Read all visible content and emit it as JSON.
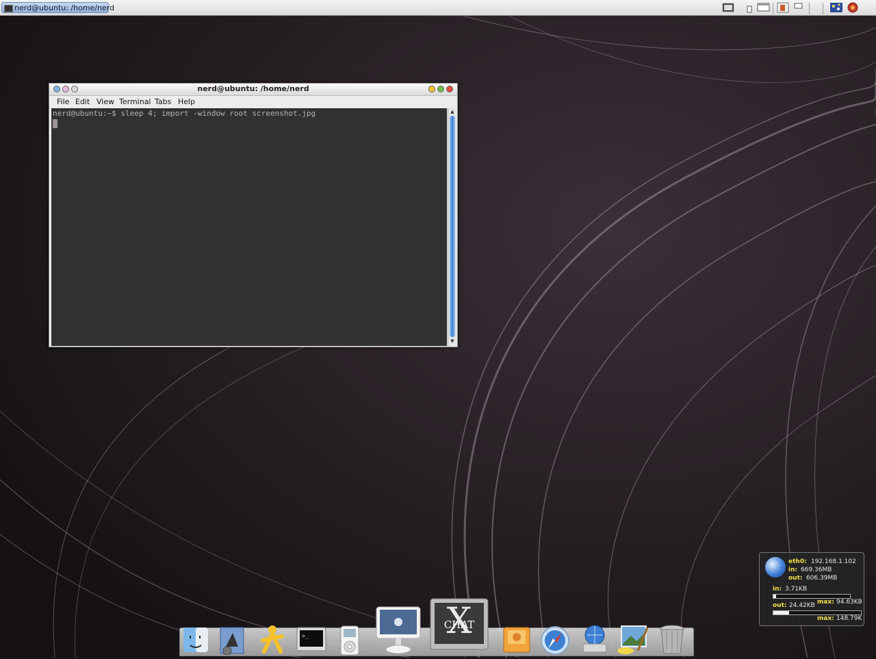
{
  "taskbar": {
    "window_button_label": "nerd@ubuntu: /home/nerd"
  },
  "tray_icons": [
    "workspace-switcher-icon",
    "user-icon",
    "window-icon",
    "clipboard-icon",
    "window-list-icon",
    "network-icon",
    "stars-icon",
    "power-icon"
  ],
  "terminal": {
    "title": "nerd@ubuntu: /home/nerd",
    "menus": [
      "File",
      "Edit",
      "View",
      "Terminal",
      "Tabs",
      "Help"
    ],
    "command_line": "nerd@ubuntu:~$ sleep 4; import -window root screenshot.jpg"
  },
  "netmon": {
    "iface_label": "eth0:",
    "ip": "192.168.1.102",
    "total_in_label": "in:",
    "total_in": "669.36MB",
    "total_out_label": "out:",
    "total_out": "606.39MB",
    "in_label": "in:",
    "in_rate": "3.71KB",
    "in_fill": 0.04,
    "out_label": "out:",
    "out_rate": "24.42KB",
    "out_fill": 0.18,
    "max_label_1": "max:",
    "max_in": "94.63KB",
    "max_label_2": "max:",
    "max_out": "148.79K"
  },
  "dock": {
    "icons": [
      "finder-icon",
      "mail-icon",
      "aim-icon",
      "terminal-icon",
      "ipod-icon",
      "imac-icon",
      "xchat-icon",
      "firefox-icon",
      "safari-icon",
      "network-drive-icon",
      "paint-icon",
      "trash-icon"
    ],
    "xchat_letter": "X",
    "xchat_word": "CHAT"
  },
  "colors": {
    "accent_blue": "#3d7fd3",
    "netmon_key": "#f2e14a",
    "wallpaper_base": "#1b1619"
  }
}
